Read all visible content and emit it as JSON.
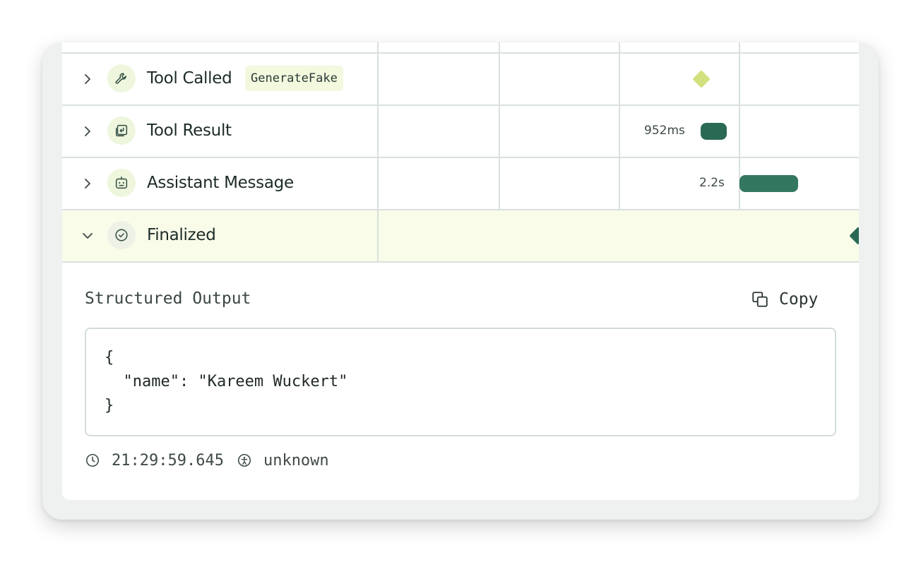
{
  "rows": [
    {
      "label": "Tool Called",
      "badge": "GenerateFake"
    },
    {
      "label": "Tool Result",
      "duration": "952ms"
    },
    {
      "label": "Assistant Message",
      "duration": "2.2s"
    },
    {
      "label": "Finalized"
    }
  ],
  "output": {
    "title": "Structured Output",
    "copy_label": "Copy",
    "code_lines": [
      "{",
      "  \"name\": \"Kareem Wuckert\"",
      "}"
    ]
  },
  "meta": {
    "timestamp": "21:29:59.645",
    "actor": "unknown"
  },
  "colors": {
    "accent_dark": "#2a6a55",
    "accent_light": "#d3e07e",
    "selected_bg": "#f8fce9",
    "icon_bg": "#eef6dd"
  }
}
